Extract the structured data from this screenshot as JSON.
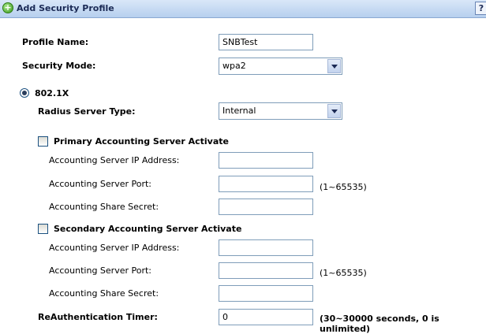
{
  "header": {
    "title": "Add Security Profile",
    "help_label": "?"
  },
  "form": {
    "profile_name_label": "Profile Name:",
    "profile_name_value": "SNBTest",
    "security_mode_label": "Security Mode:",
    "security_mode_value": "wpa2",
    "mode_8021x_label": "802.1X",
    "radius_server_type_label": "Radius Server Type:",
    "radius_server_type_value": "Internal",
    "primary": {
      "activate_label": "Primary Accounting Server Activate",
      "ip_label": "Accounting Server IP Address:",
      "ip_value": "",
      "port_label": "Accounting Server Port:",
      "port_value": "",
      "port_hint": "(1~65535)",
      "secret_label": "Accounting Share Secret:",
      "secret_value": ""
    },
    "secondary": {
      "activate_label": "Secondary Accounting Server Activate",
      "ip_label": "Accounting Server IP Address:",
      "ip_value": "",
      "port_label": "Accounting Server Port:",
      "port_value": "",
      "port_hint": "(1~65535)",
      "secret_label": "Accounting Share Secret:",
      "secret_value": ""
    },
    "reauth_label": "ReAuthentication Timer:",
    "reauth_value": "0",
    "reauth_hint": "(30~30000 seconds, 0 is unlimited)"
  }
}
